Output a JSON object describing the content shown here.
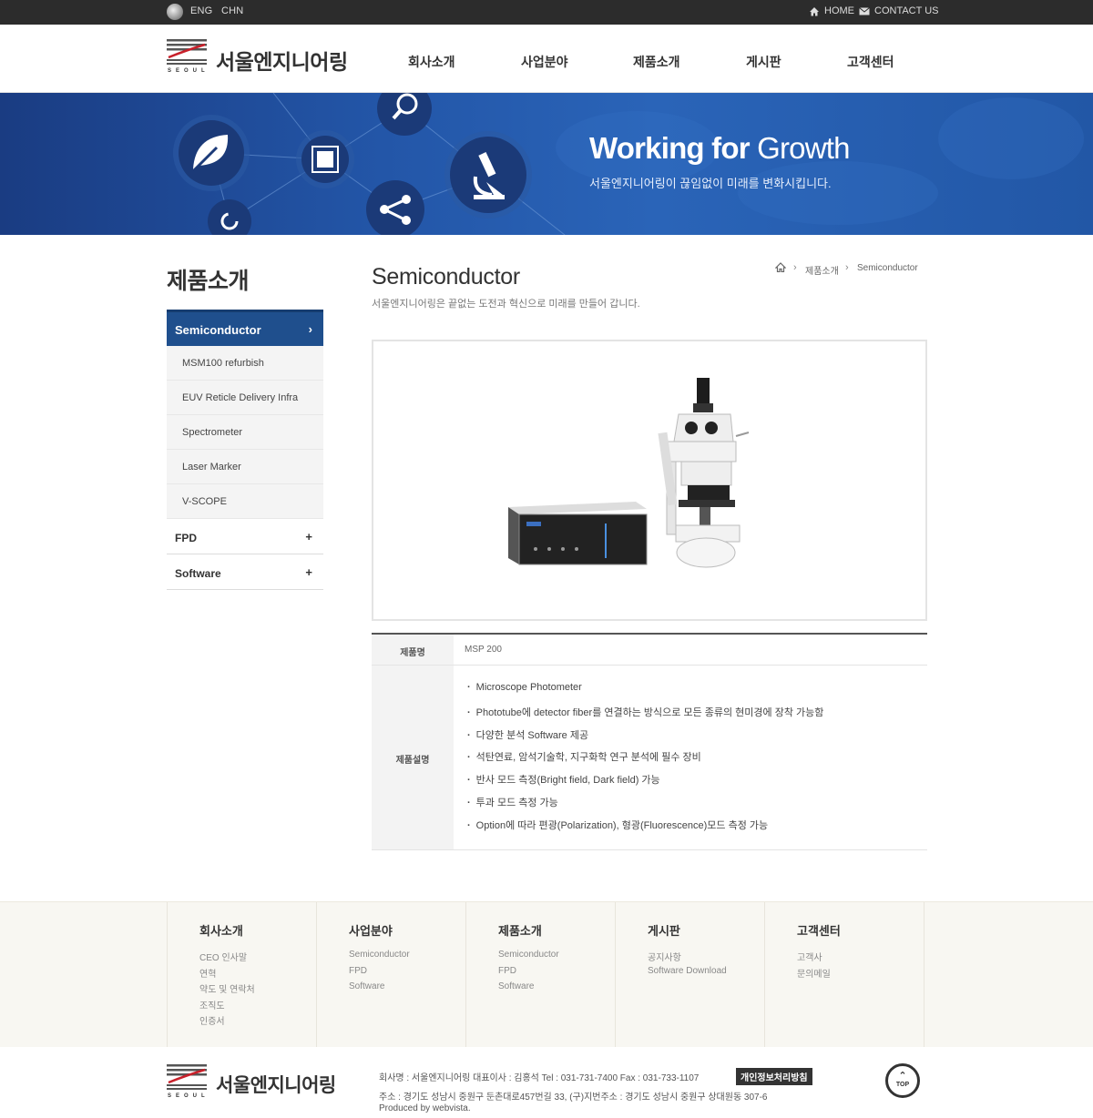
{
  "topbar": {
    "lang_eng": "ENG",
    "lang_chn": "CHN",
    "home": "HOME",
    "contact": "CONTACT US"
  },
  "header": {
    "logo_text": "서울엔지니어링",
    "logo_sub": "SEOUL",
    "nav": [
      "회사소개",
      "사업분야",
      "제품소개",
      "게시판",
      "고객센터"
    ]
  },
  "banner": {
    "title_bold": "Working for ",
    "title_light": "Growth",
    "subtitle": "서울엔지니어링이 끊임없이 미래를 변화시킵니다."
  },
  "sidebar": {
    "title": "제품소개",
    "active": "Semiconductor",
    "sub_items": [
      "MSM100 refurbish",
      "EUV Reticle Delivery Infra",
      "Spectrometer",
      "Laser Marker",
      "V-SCOPE"
    ],
    "main_items": [
      "FPD",
      "Software"
    ]
  },
  "content": {
    "title": "Semiconductor",
    "description": "서울엔지니어링은 끝없는 도전과 혁신으로 미래를 만들어 갑니다.",
    "breadcrumb": [
      "제품소개",
      "Semiconductor"
    ],
    "spec": {
      "name_label": "제품명",
      "name_value": "MSP 200",
      "desc_label": "제품설명",
      "desc_items": [
        "Microscope Photometer",
        "Phototube에 detector fiber를 연결하는 방식으로 모든 종류의 현미경에 장착 가능함",
        "다양한 분석 Software 제공",
        "석탄연료, 암석기술학, 지구화학 연구 분석에 필수 장비",
        "반사 모드 측정(Bright field, Dark field) 가능",
        "투과 모드 측정 가능",
        "Option에 따라 편광(Polarization), 형광(Fluorescence)모드 측정 가능"
      ]
    }
  },
  "footer": {
    "columns": [
      {
        "title": "회사소개",
        "links": [
          "CEO 인사말",
          "연혁",
          "약도 및 연락처",
          "조직도",
          "인증서"
        ]
      },
      {
        "title": "사업분야",
        "links": [
          "Semiconductor",
          "FPD",
          "Software"
        ]
      },
      {
        "title": "제품소개",
        "links": [
          "Semiconductor",
          "FPD",
          "Software"
        ]
      },
      {
        "title": "게시판",
        "links": [
          "공지사항",
          "Software Download"
        ]
      },
      {
        "title": "고객센터",
        "links": [
          "고객사",
          "문의메일"
        ]
      }
    ],
    "logo_text": "서울엔지니어링",
    "logo_sub": "SEOUL",
    "info_line1": "회사명 : 서울엔지니어링   대표이사 : 김홍석   Tel : 031-731-7400   Fax : 031-733-1107",
    "privacy": "개인정보처리방침",
    "info_line2": "주소 : 경기도 성남시 중원구 둔촌대로457번길 33, (구)지번주소 : 경기도 성남시 중원구 상대원동 307-6",
    "info_line3": "Produced by webvista.",
    "top_label": "TOP"
  },
  "colors": {
    "lnb_active": "#1f4f8d",
    "banner": "#2356a8",
    "topbar": "#2c2c2c"
  }
}
